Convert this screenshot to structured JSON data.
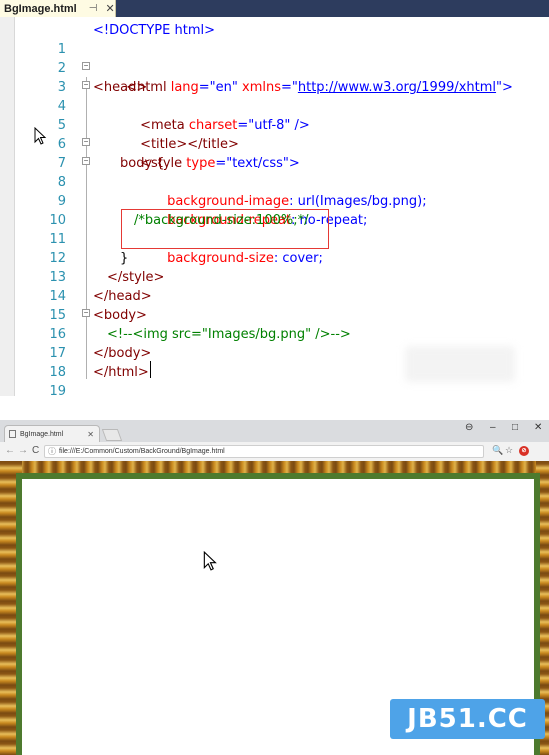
{
  "editor": {
    "tab_label": "BgImage.html",
    "tab_pin": "⊣",
    "tab_close": "✕",
    "lines": [
      {
        "n": "1"
      },
      {
        "n": "2"
      },
      {
        "n": "3"
      },
      {
        "n": "4"
      },
      {
        "n": "5"
      },
      {
        "n": "6"
      },
      {
        "n": "7"
      },
      {
        "n": "8"
      },
      {
        "n": "9"
      },
      {
        "n": "10"
      },
      {
        "n": "11"
      },
      {
        "n": "12"
      },
      {
        "n": "13"
      },
      {
        "n": "14"
      },
      {
        "n": "15"
      },
      {
        "n": "16"
      },
      {
        "n": "17"
      },
      {
        "n": "18"
      },
      {
        "n": "19"
      }
    ],
    "code": {
      "l1": "<!DOCTYPE html>",
      "l3_open": "<html",
      "l3_attr1": " lang",
      "l3_val1": "=\"en\"",
      "l3_attr2": " xmlns",
      "l3_eq": "=\"",
      "l3_link": "http://www.w3.org/1999/xhtml",
      "l3_close": "\">",
      "l4": "<head>",
      "l5_open": "<meta",
      "l5_attr": " charset",
      "l5_val": "=\"utf-8\"",
      "l5_close": " />",
      "l6_open": "<title>",
      "l6_close": "</title>",
      "l7_open": "<style",
      "l7_attr": " type",
      "l7_val": "=\"text/css\"",
      "l7_close": ">",
      "l8": "body {",
      "l9_prop": "background-image",
      "l9_val": ": url(Images/bg.png);",
      "l10_prop": "background-repeat",
      "l10_val": ": no-repeat;",
      "l11": "/*background-size:100%;*/",
      "l12_prop": "background-size",
      "l12_val": ": cover;",
      "l13": "}",
      "l14": "</style>",
      "l15": "</head>",
      "l16": "<body>",
      "l17": "<!--<img src=\"Images/bg.png\" />-->",
      "l18": "</body>",
      "l19": "</html>"
    }
  },
  "browser": {
    "tab_title": "BgImage.html",
    "tab_close": "✕",
    "win_controls": [
      "⊖",
      "–",
      "□",
      "✕"
    ],
    "nav": {
      "back": "←",
      "forward": "→",
      "reload": "C"
    },
    "info_icon": "ⓘ",
    "url": "file:///E:/Common/Custom/BackGround/BgImage.html",
    "zoom_icon": "🔍",
    "star_icon": "☆",
    "stop_label": "⊘"
  },
  "watermark": "JB51.CC"
}
